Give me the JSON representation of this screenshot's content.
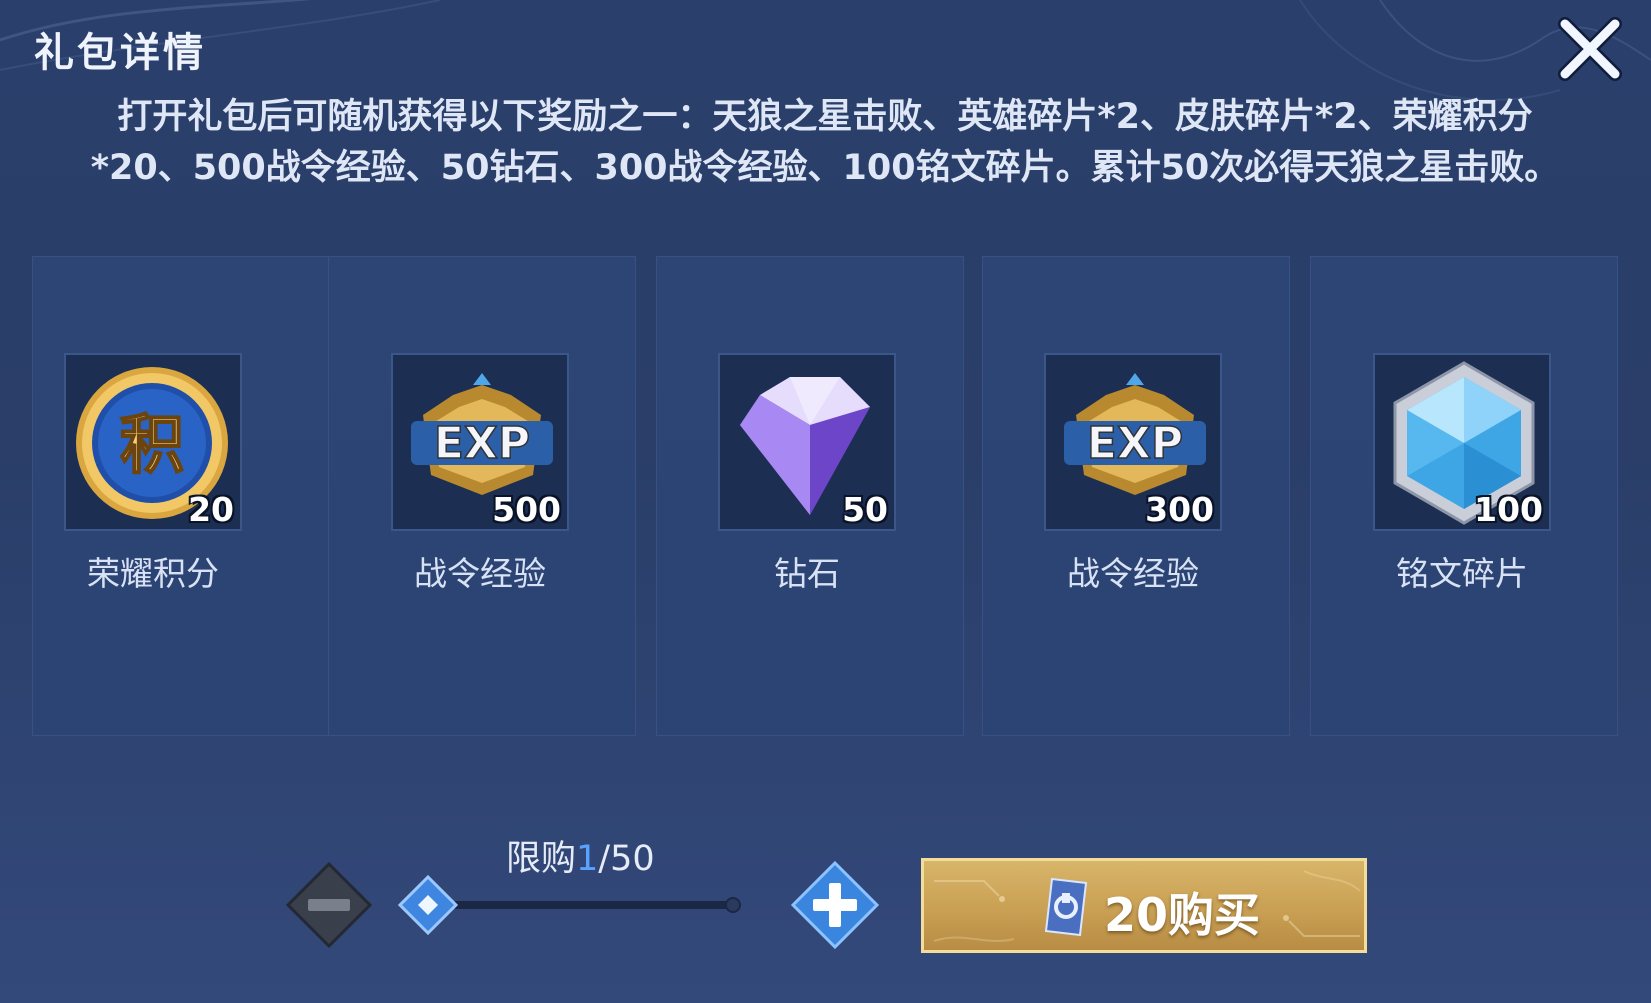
{
  "dialog": {
    "title": "礼包详情",
    "description": "打开礼包后可随机获得以下奖励之一：天狼之星击败、英雄碎片*2、皮肤碎片*2、荣耀积分*20、500战令经验、50钻石、300战令经验、100铭文碎片。累计50次必得天狼之星击败。",
    "close_icon": "close-x-icon"
  },
  "rewards": [
    {
      "icon": "honor-points-icon",
      "quantity": "20",
      "label": "荣耀积分"
    },
    {
      "icon": "battle-pass-exp-icon",
      "quantity": "500",
      "label": "战令经验"
    },
    {
      "icon": "diamond-icon",
      "quantity": "50",
      "label": "钻石"
    },
    {
      "icon": "battle-pass-exp-icon",
      "quantity": "300",
      "label": "战令经验"
    },
    {
      "icon": "inscription-fragment-icon",
      "quantity": "100",
      "label": "铭文碎片"
    }
  ],
  "purchase": {
    "limit_label": "限购",
    "current": "1",
    "separator_max": "/50",
    "slider_fraction": 0.0,
    "buy_label": "20购买",
    "currency_icon": "coupon-icon"
  },
  "colors": {
    "background": "#2a3f6b",
    "card": "#2d4575",
    "accent_blue": "#5aa2ff",
    "buy_gold": "#c9a054"
  }
}
